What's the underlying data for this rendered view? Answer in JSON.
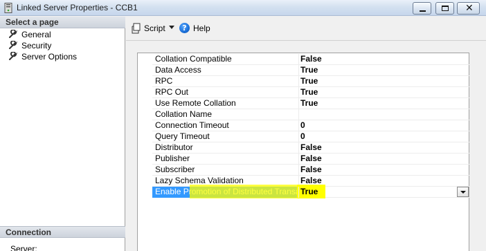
{
  "window": {
    "title": "Linked Server Properties - CCB1"
  },
  "left_pane": {
    "select_page_header": "Select a page",
    "pages": [
      {
        "label": "General",
        "icon": "wrench-icon"
      },
      {
        "label": "Security",
        "icon": "wrench-icon"
      },
      {
        "label": "Server Options",
        "icon": "wrench-icon"
      }
    ],
    "connection_header": "Connection",
    "server_label": "Server:"
  },
  "toolbar": {
    "script_label": "Script",
    "help_label": "Help"
  },
  "properties": [
    {
      "name": "Collation Compatible",
      "value": "False"
    },
    {
      "name": "Data Access",
      "value": "True"
    },
    {
      "name": "RPC",
      "value": "True"
    },
    {
      "name": "RPC Out",
      "value": "True"
    },
    {
      "name": "Use Remote Collation",
      "value": "True"
    },
    {
      "name": "Collation Name",
      "value": ""
    },
    {
      "name": "Connection Timeout",
      "value": "0"
    },
    {
      "name": "Query Timeout",
      "value": "0"
    },
    {
      "name": "Distributor",
      "value": "False"
    },
    {
      "name": "Publisher",
      "value": "False"
    },
    {
      "name": "Subscriber",
      "value": "False"
    },
    {
      "name": "Lazy Schema Validation",
      "value": "False"
    },
    {
      "name": "Enable Promotion of Distributed Transaction",
      "value": "True"
    }
  ],
  "selected_row_index": 12,
  "colors": {
    "selection": "#3399ff",
    "highlight": "#ffff00",
    "help_icon": "#1a6fd8"
  }
}
